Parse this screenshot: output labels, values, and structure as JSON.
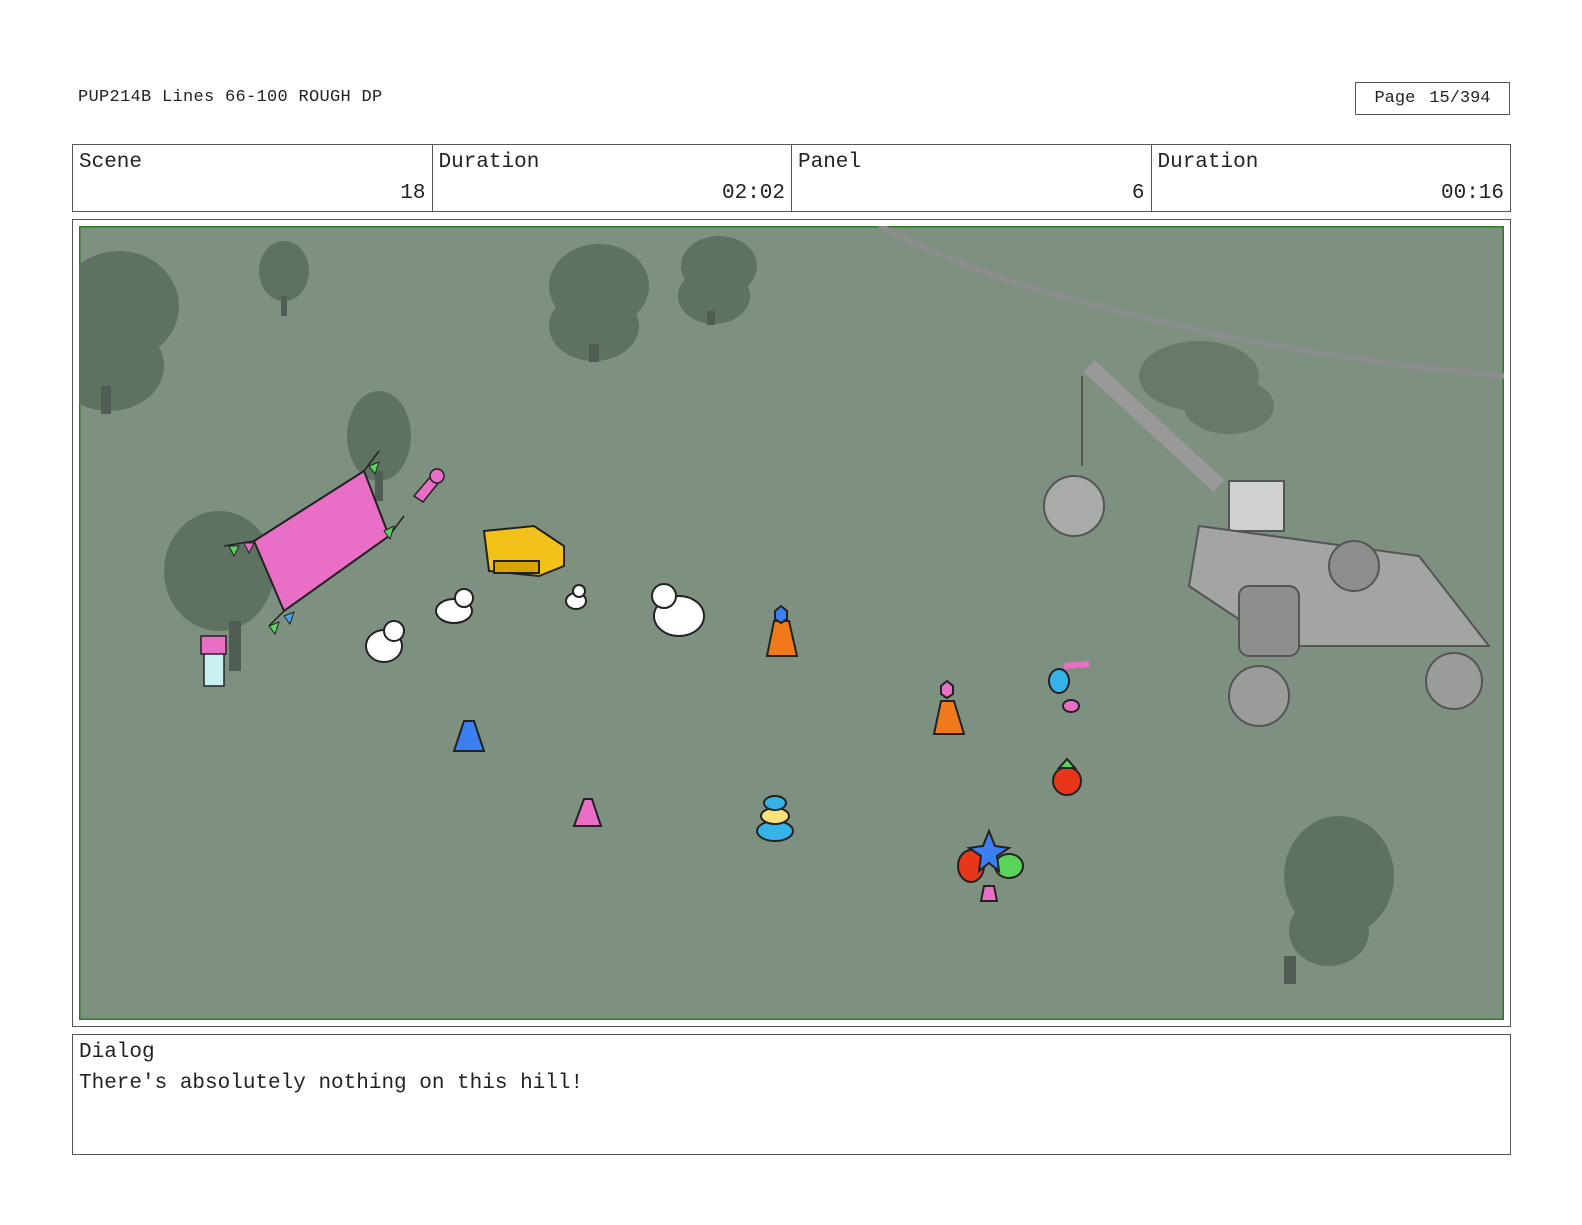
{
  "header": {
    "title": "PUP214B Lines 66-100 ROUGH DP",
    "page_label": "Page",
    "page_value": "15/394"
  },
  "info": {
    "scene_label": "Scene",
    "scene_value": "18",
    "scene_duration_label": "Duration",
    "scene_duration_value": "02:02",
    "panel_label": "Panel",
    "panel_value": "6",
    "panel_duration_label": "Duration",
    "panel_duration_value": "00:16"
  },
  "panel_art": {
    "background_color": "#7e9080",
    "frame_color": "#2d7a2d",
    "tree_color": "#5e7262"
  },
  "dialog": {
    "label": "Dialog",
    "text": "There's absolutely nothing on this hill!"
  }
}
